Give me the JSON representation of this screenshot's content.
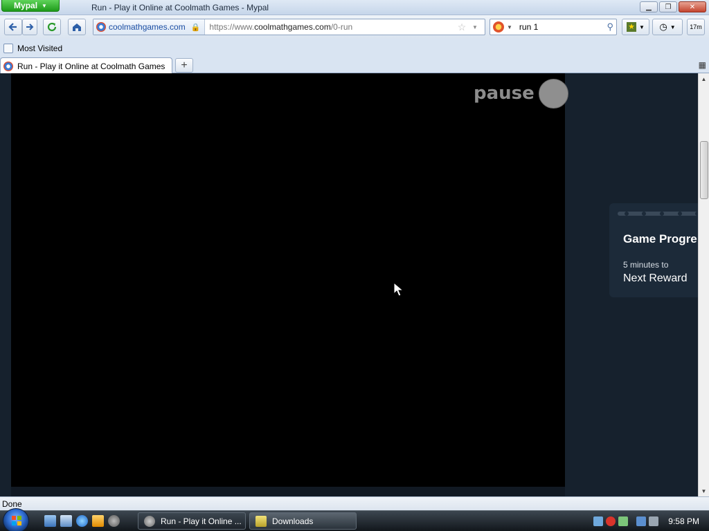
{
  "window": {
    "app_button": "Mypal",
    "title": "Run - Play it Online at Coolmath Games - Mypal"
  },
  "nav": {
    "site_identity": "coolmathgames.com",
    "url_prefix": "https://www.",
    "url_host": "coolmathgames.com",
    "url_path": "/0-run",
    "search_value": "run 1",
    "history_badge": "17m"
  },
  "bookmarks": {
    "most_visited": "Most Visited"
  },
  "tabs": [
    {
      "label": "Run - Play it Online at Coolmath Games"
    }
  ],
  "game": {
    "pause_label": "pause"
  },
  "progress": {
    "title": "Game Progre",
    "subtitle": "5 minutes to",
    "reward": "Next Reward"
  },
  "status": {
    "text": "Done"
  },
  "taskbar": {
    "tasks": [
      {
        "label": "Run - Play it Online ..."
      },
      {
        "label": "Downloads"
      }
    ],
    "clock": "9:58 PM"
  },
  "colors": {
    "app_button": "#1e9b1a",
    "page_background": "#16212d",
    "game_background": "#000000"
  }
}
